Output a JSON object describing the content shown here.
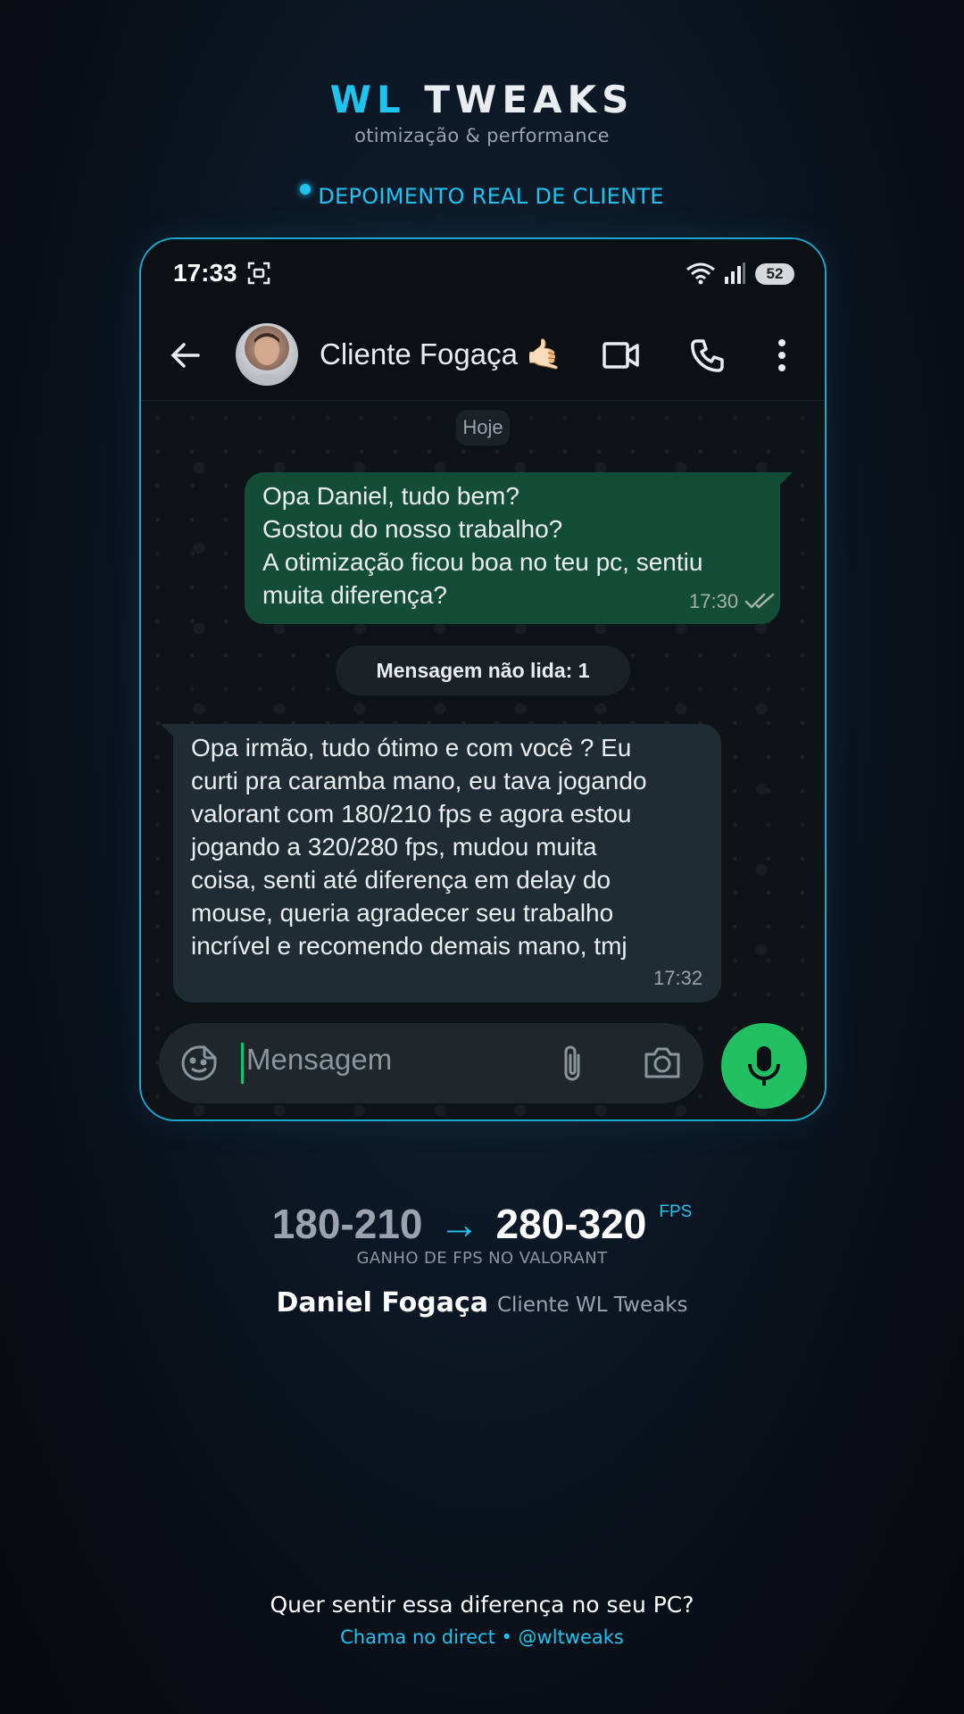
{
  "brand": {
    "wl": "WL",
    "tweaks": "TWEAKS",
    "subtitle": "otimização & performance"
  },
  "badge": {
    "label": "DEPOIMENTO REAL DE CLIENTE"
  },
  "phone": {
    "status": {
      "time": "17:33",
      "battery": "52"
    },
    "appbar": {
      "contact_name": "Cliente Fogaça 🤙🏻"
    },
    "chat": {
      "date_chip": "Hoje",
      "outgoing": {
        "lines": [
          "Opa Daniel, tudo bem?",
          "Gostou do nosso trabalho?",
          "A otimização ficou boa no teu pc, sentiu",
          "muita diferença?"
        ],
        "time": "17:30"
      },
      "unread_label": "Mensagem não lida: 1",
      "incoming": {
        "lines": [
          "Opa irmão, tudo ótimo e com você ? Eu",
          "curti pra caramba mano, eu tava jogando",
          "valorant com 180/210 fps e agora estou",
          "jogando a 320/280 fps, mudou muita",
          "coisa, senti até diferença em delay do",
          "mouse, queria agradecer seu trabalho",
          "incrível e recomendo demais mano, tmj"
        ],
        "time": "17:32"
      },
      "composer": {
        "placeholder": "Mensagem"
      }
    },
    "colors": {
      "accent": "#1fc3f0",
      "outgoing_bubble": "#144d37",
      "incoming_bubble": "#202c33",
      "mic_button": "#21c063"
    }
  },
  "fps": {
    "before": "180-210",
    "arrow": "→",
    "after": "280-320",
    "unit": "FPS",
    "label": "GANHO DE FPS NO VALORANT"
  },
  "author": {
    "name": "Daniel Fogaça",
    "role": "Cliente WL Tweaks"
  },
  "cta": {
    "main": "Quer sentir essa diferença no seu PC?",
    "sub": "Chama no direct • @wltweaks"
  }
}
